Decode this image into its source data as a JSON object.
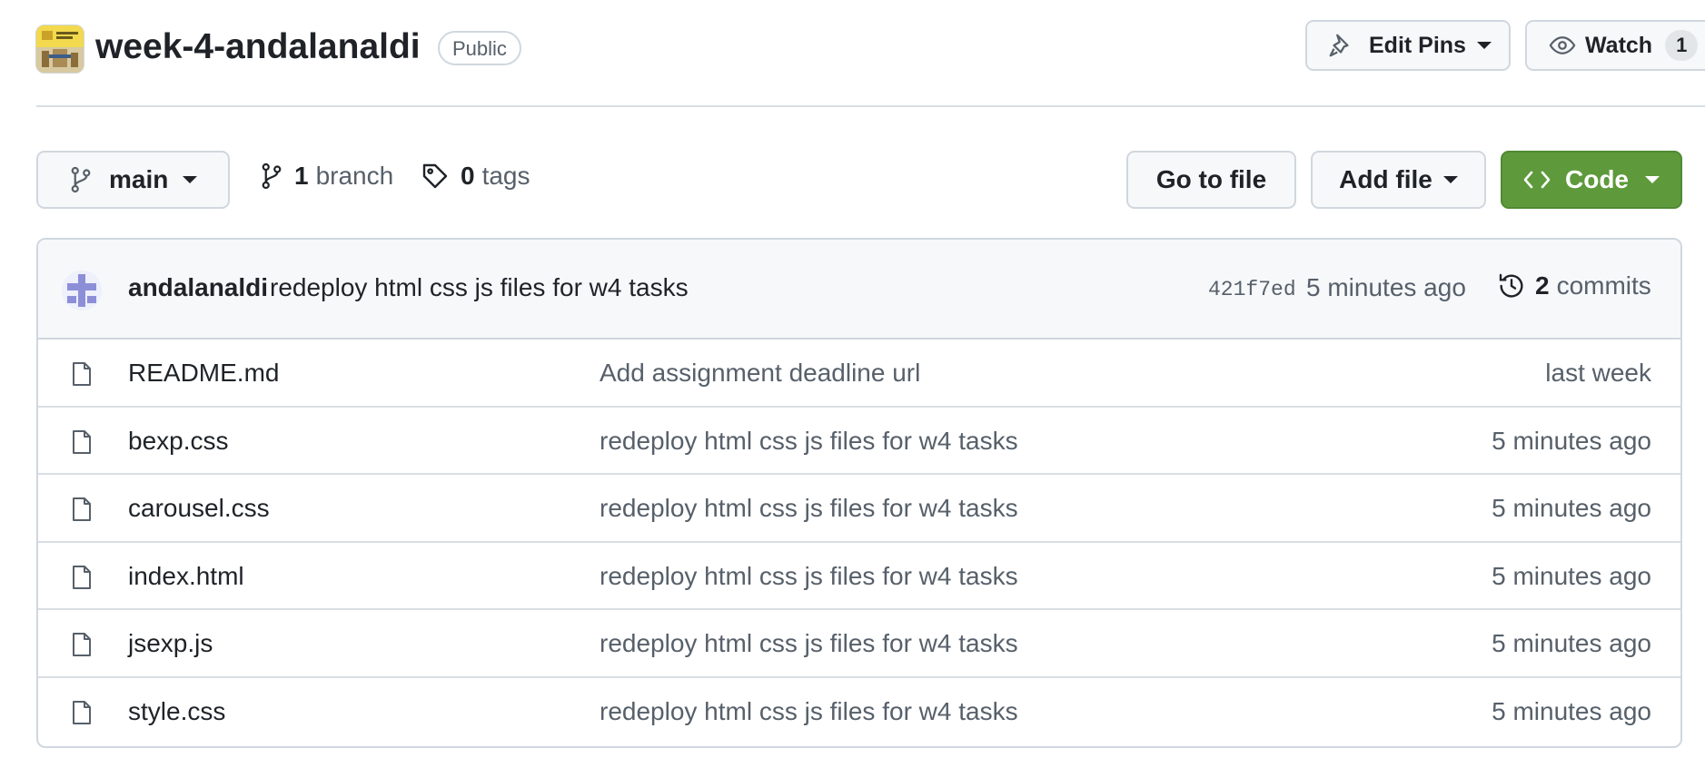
{
  "repo": {
    "name": "week-4-andalanaldi",
    "visibility": "Public"
  },
  "header_actions": {
    "edit_pins_label": "Edit Pins",
    "watch_label": "Watch",
    "watch_count": "1"
  },
  "toolbar": {
    "branch": "main",
    "branch_count": "1",
    "branch_word": "branch",
    "tag_count": "0",
    "tag_word": "tags",
    "go_to_file": "Go to file",
    "add_file": "Add file",
    "code": "Code"
  },
  "latest_commit": {
    "author": "andalanaldi",
    "message": "redeploy html css js files for w4 tasks",
    "sha": "421f7ed",
    "time": "5 minutes ago",
    "commit_count": "2",
    "commit_word": "commits"
  },
  "files": [
    {
      "name": "README.md",
      "message": "Add assignment deadline url",
      "time": "last week"
    },
    {
      "name": "bexp.css",
      "message": "redeploy html css js files for w4 tasks",
      "time": "5 minutes ago"
    },
    {
      "name": "carousel.css",
      "message": "redeploy html css js files for w4 tasks",
      "time": "5 minutes ago"
    },
    {
      "name": "index.html",
      "message": "redeploy html css js files for w4 tasks",
      "time": "5 minutes ago"
    },
    {
      "name": "jsexp.js",
      "message": "redeploy html css js files for w4 tasks",
      "time": "5 minutes ago"
    },
    {
      "name": "style.css",
      "message": "redeploy html css js files for w4 tasks",
      "time": "5 minutes ago"
    }
  ],
  "icons": {
    "repo_avatar": "repo-avatar-image",
    "pin": "pin-icon",
    "eye": "eye-icon",
    "branch": "git-branch-icon",
    "tag": "tag-icon",
    "code": "code-icon",
    "history": "history-icon",
    "file": "file-icon"
  },
  "colors": {
    "code_button": "#5e9a3c",
    "muted_text": "#57606a",
    "border": "#d0d7de"
  }
}
